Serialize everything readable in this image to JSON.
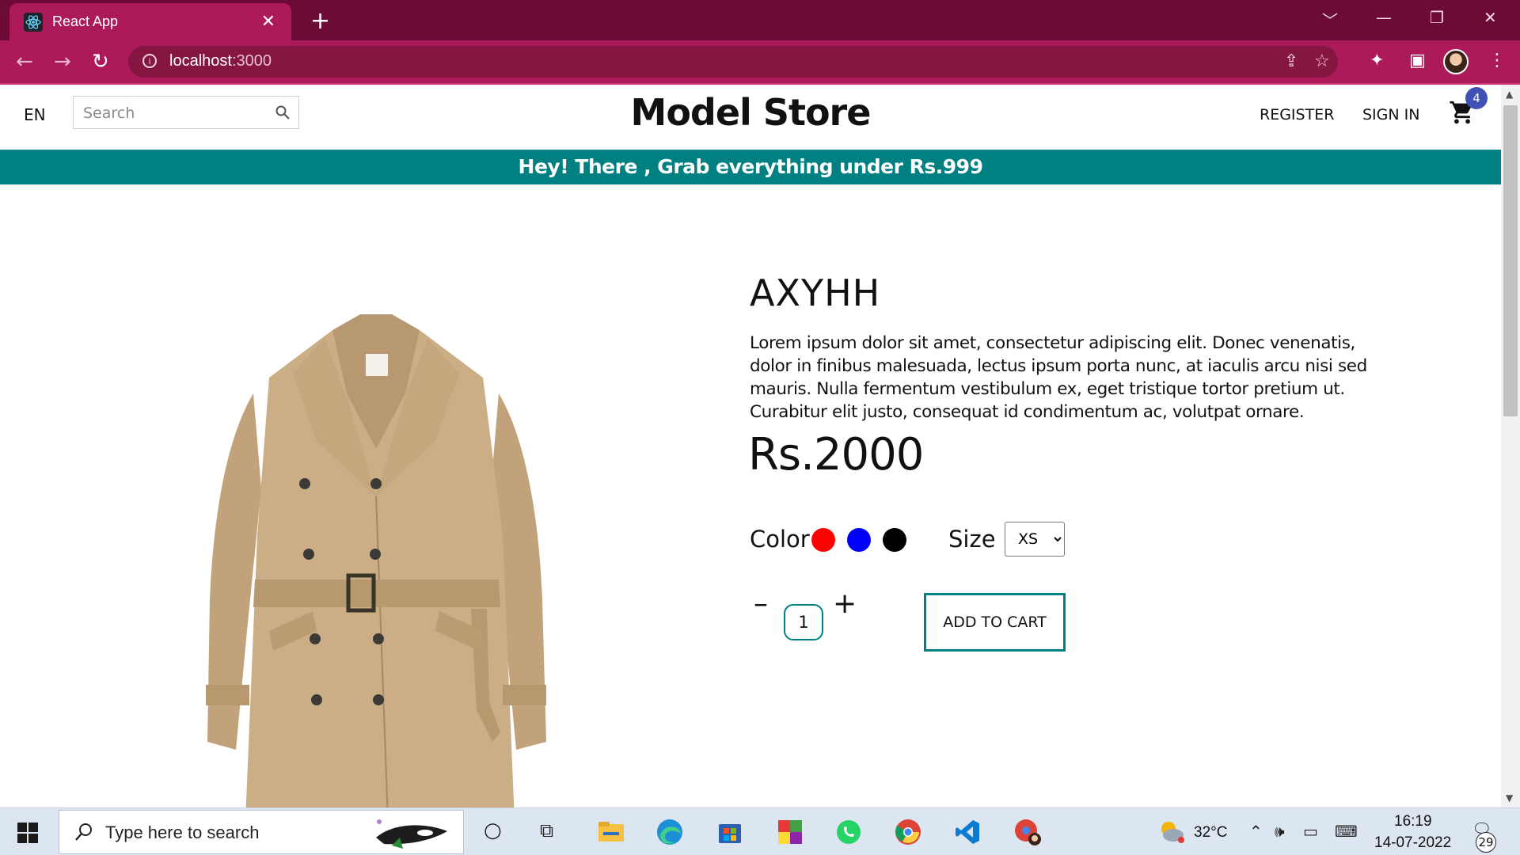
{
  "browser": {
    "tab_title": "React App",
    "tab_close": "✕",
    "new_tab": "+",
    "url_host": "localhost",
    "url_port": ":3000",
    "window_controls": [
      "﹀",
      "—",
      "❐",
      "✕"
    ]
  },
  "header": {
    "language": "EN",
    "search_placeholder": "Search",
    "logo": "Model Store",
    "menu": [
      "REGISTER",
      "SIGN IN"
    ],
    "cart_count": "4"
  },
  "announcement": "Hey! There , Grab everything under Rs.999",
  "product": {
    "title": "AXYHH",
    "description": "Lorem ipsum dolor sit amet, consectetur adipiscing elit. Donec venenatis, dolor in finibus malesuada, lectus ipsum porta nunc, at iaculis arcu nisi sed mauris. Nulla fermentum vestibulum ex, eget tristique tortor pretium ut. Curabitur elit justo, consequat id condimentum ac, volutpat ornare.",
    "price": "Rs.2000",
    "color_label": "Color",
    "colors": [
      "#ff0000",
      "#0000ff",
      "#000000"
    ],
    "size_label": "Size",
    "size_selected": "XS",
    "quantity": "1",
    "decrement": "–",
    "increment": "+",
    "add_to_cart": "ADD TO CART"
  },
  "taskbar": {
    "search_placeholder": "Type here to search",
    "weather": "32°C",
    "time": "16:19",
    "date": "14-07-2022",
    "notifications": "29"
  }
}
